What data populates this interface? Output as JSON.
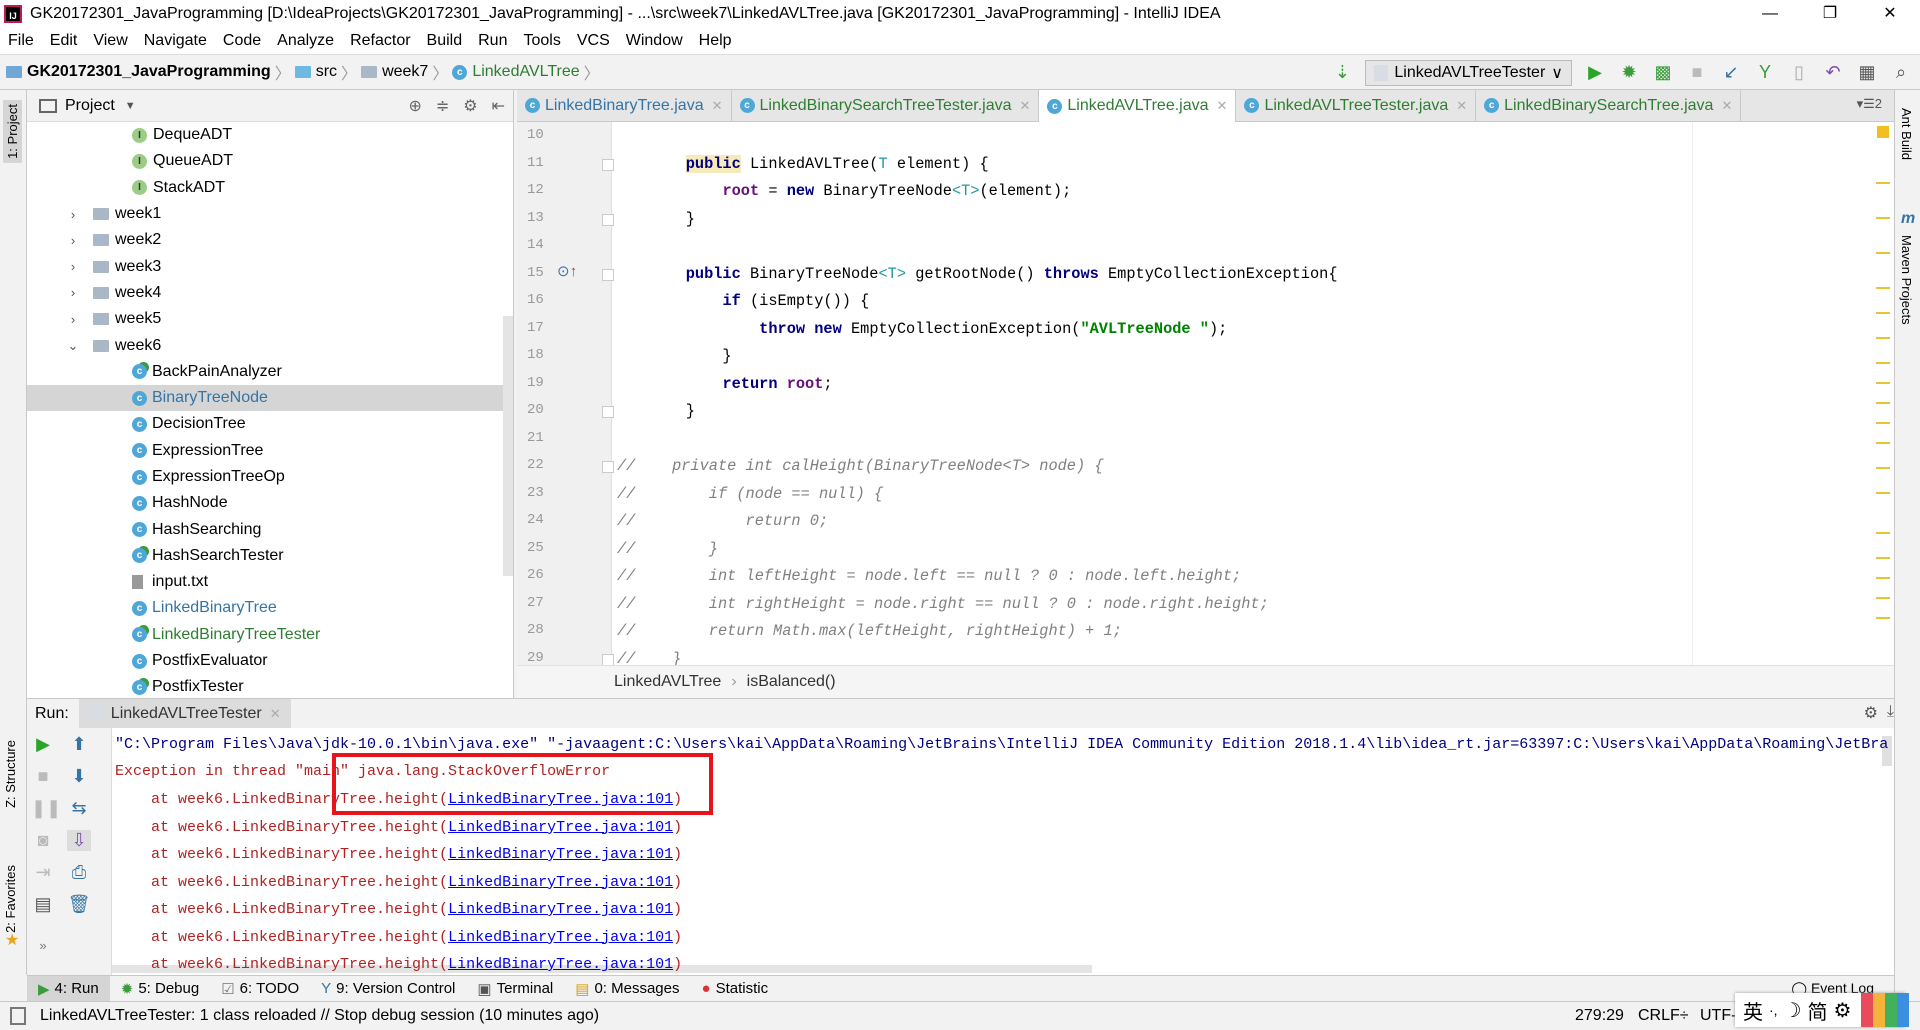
{
  "window": {
    "title": "GK20172301_JavaProgramming [D:\\IdeaProjects\\GK20172301_JavaProgramming] - ...\\src\\week7\\LinkedAVLTree.java [GK20172301_JavaProgramming] - IntelliJ IDEA",
    "minimize": "—",
    "restore": "❐",
    "close": "✕"
  },
  "menu": [
    "File",
    "Edit",
    "View",
    "Navigate",
    "Code",
    "Analyze",
    "Refactor",
    "Build",
    "Run",
    "Tools",
    "VCS",
    "Window",
    "Help"
  ],
  "nav": {
    "project": "GK20172301_JavaProgramming",
    "src": "src",
    "week": "week7",
    "file": "LinkedAVLTree",
    "sep": "〉"
  },
  "toolbar": {
    "run_config": "LinkedAVLTreeTester",
    "dropdown": "∨",
    "icons": [
      "sort-icon",
      "run-icon",
      "debug-icon",
      "coverage-icon",
      "stop-icon",
      "vcs-update-icon",
      "vcs-commit-icon",
      "vcs-compare-icon",
      "vcs-revert-icon",
      "project-structure-icon",
      "search-icon"
    ]
  },
  "left_strip": {
    "project": "1: Project",
    "structure": "Z: Structure",
    "favorites": "2: Favorites"
  },
  "right_strip": {
    "ant": "Ant Build",
    "maven": "Maven Projects"
  },
  "project_panel": {
    "title": "Project",
    "tree": [
      {
        "label": "DequeADT",
        "icon": "interface",
        "indent": 3
      },
      {
        "label": "QueueADT",
        "icon": "interface",
        "indent": 3
      },
      {
        "label": "StackADT",
        "icon": "interface",
        "indent": 3
      },
      {
        "label": "week1",
        "icon": "folder",
        "indent": 2,
        "arrow": "›"
      },
      {
        "label": "week2",
        "icon": "folder",
        "indent": 2,
        "arrow": "›"
      },
      {
        "label": "week3",
        "icon": "folder",
        "indent": 2,
        "arrow": "›"
      },
      {
        "label": "week4",
        "icon": "folder",
        "indent": 2,
        "arrow": "›"
      },
      {
        "label": "week5",
        "icon": "folder",
        "indent": 2,
        "arrow": "›"
      },
      {
        "label": "week6",
        "icon": "folder",
        "indent": 2,
        "arrow": "⌄"
      },
      {
        "label": "BackPainAnalyzer",
        "icon": "class-main",
        "indent": 3
      },
      {
        "label": "BinaryTreeNode",
        "icon": "class",
        "indent": 3,
        "selected": true,
        "color": "#3574a5"
      },
      {
        "label": "DecisionTree",
        "icon": "class",
        "indent": 3
      },
      {
        "label": "ExpressionTree",
        "icon": "class",
        "indent": 3
      },
      {
        "label": "ExpressionTreeOp",
        "icon": "class",
        "indent": 3
      },
      {
        "label": "HashNode",
        "icon": "class",
        "indent": 3
      },
      {
        "label": "HashSearching",
        "icon": "class",
        "indent": 3
      },
      {
        "label": "HashSearchTester",
        "icon": "class-main",
        "indent": 3
      },
      {
        "label": "input.txt",
        "icon": "text",
        "indent": 3
      },
      {
        "label": "LinkedBinaryTree",
        "icon": "class",
        "indent": 3,
        "color": "#3574a5"
      },
      {
        "label": "LinkedBinaryTreeTester",
        "icon": "class-main",
        "indent": 3,
        "color": "#2f7d32"
      },
      {
        "label": "PostfixEvaluator",
        "icon": "class",
        "indent": 3
      },
      {
        "label": "PostfixTester",
        "icon": "class-main",
        "indent": 3
      }
    ]
  },
  "tabs": [
    {
      "label": "LinkedBinaryTree.java",
      "color": "blue"
    },
    {
      "label": "LinkedBinarySearchTreeTester.java",
      "color": "green"
    },
    {
      "label": "LinkedAVLTree.java",
      "color": "green",
      "active": true
    },
    {
      "label": "LinkedAVLTreeTester.java",
      "color": "green"
    },
    {
      "label": "LinkedBinarySearchTree.java",
      "color": "green"
    }
  ],
  "tabs_overflow": "▾☰2",
  "editor": {
    "lines": [
      {
        "n": "10",
        "t": []
      },
      {
        "n": "11",
        "t": [
          [
            "    ",
            ""
          ],
          [
            "public",
            "kw hl"
          ],
          [
            " LinkedAVLTree(",
            ""
          ],
          [
            "T",
            "typ"
          ],
          [
            " element) {",
            ""
          ]
        ]
      },
      {
        "n": "12",
        "t": [
          [
            "        ",
            ""
          ],
          [
            "root",
            "fld"
          ],
          [
            " = ",
            ""
          ],
          [
            "new",
            "kw"
          ],
          [
            " BinaryTreeNode",
            ""
          ],
          [
            "<T>",
            "typ"
          ],
          [
            "(element);",
            ""
          ]
        ]
      },
      {
        "n": "13",
        "t": [
          [
            "    }",
            ""
          ]
        ]
      },
      {
        "n": "14",
        "t": []
      },
      {
        "n": "15",
        "t": [
          [
            "    ",
            ""
          ],
          [
            "public",
            "kw"
          ],
          [
            " BinaryTreeNode",
            ""
          ],
          [
            "<T>",
            "typ"
          ],
          [
            " getRootNode() ",
            ""
          ],
          [
            "throws",
            "kw"
          ],
          [
            " EmptyCollectionException{",
            ""
          ]
        ]
      },
      {
        "n": "16",
        "t": [
          [
            "        ",
            ""
          ],
          [
            "if",
            "kw"
          ],
          [
            " (isEmpty()) {",
            ""
          ]
        ]
      },
      {
        "n": "17",
        "t": [
          [
            "            ",
            ""
          ],
          [
            "throw new",
            "kw"
          ],
          [
            " EmptyCollectionException(",
            ""
          ],
          [
            "\"AVLTreeNode \"",
            "str"
          ],
          [
            ");",
            ""
          ]
        ]
      },
      {
        "n": "18",
        "t": [
          [
            "        }",
            ""
          ]
        ]
      },
      {
        "n": "19",
        "t": [
          [
            "        ",
            ""
          ],
          [
            "return",
            "kw"
          ],
          [
            " ",
            ""
          ],
          [
            "root",
            "fld"
          ],
          [
            ";",
            ""
          ]
        ]
      },
      {
        "n": "20",
        "t": [
          [
            "    }",
            ""
          ]
        ]
      },
      {
        "n": "21",
        "t": []
      },
      {
        "n": "22",
        "t": [
          [
            "//    private int calHeight(BinaryTreeNode<T> node) {",
            "cm"
          ]
        ]
      },
      {
        "n": "23",
        "t": [
          [
            "//        if (node == null) {",
            "cm"
          ]
        ]
      },
      {
        "n": "24",
        "t": [
          [
            "//            return 0;",
            "cm"
          ]
        ]
      },
      {
        "n": "25",
        "t": [
          [
            "//        }",
            "cm"
          ]
        ]
      },
      {
        "n": "26",
        "t": [
          [
            "//        int leftHeight = node.left == null ? 0 : node.left.height;",
            "cm"
          ]
        ]
      },
      {
        "n": "27",
        "t": [
          [
            "//        int rightHeight = node.right == null ? 0 : node.right.height;",
            "cm"
          ]
        ]
      },
      {
        "n": "28",
        "t": [
          [
            "//        return Math.max(leftHeight, rightHeight) + 1;",
            "cm"
          ]
        ]
      },
      {
        "n": "29",
        "t": [
          [
            "//    }",
            "cm"
          ]
        ]
      }
    ],
    "breadcrumb": {
      "class": "LinkedAVLTree",
      "sep": "›",
      "method": "isBalanced()"
    }
  },
  "run": {
    "label": "Run:",
    "tab": "LinkedAVLTreeTester",
    "command": "\"C:\\Program Files\\Java\\jdk-10.0.1\\bin\\java.exe\" \"-javaagent:C:\\Users\\kai\\AppData\\Roaming\\JetBrains\\IntelliJ IDEA Community Edition 2018.1.4\\lib\\idea_rt.jar=63397:C:\\Users\\kai\\AppData\\Roaming\\JetBra",
    "exception": "Exception in thread \"main\" java.lang.StackOverflowError",
    "frame_prefix": "    at week6.LinkedBinaryTree.height(",
    "frame_link": "LinkedBinaryTree.java:101",
    "frame_suffix": ")",
    "frame_count": 7
  },
  "bottom_tabs": [
    {
      "label": "4: Run",
      "icon": "▶",
      "color": "#3a9c3a",
      "active": true
    },
    {
      "label": "5: Debug",
      "icon": "✹",
      "color": "#3a9c3a"
    },
    {
      "label": "6: TODO",
      "icon": "☑",
      "color": "#777"
    },
    {
      "label": "9: Version Control",
      "icon": "Y",
      "color": "#3574a5"
    },
    {
      "label": "Terminal",
      "icon": "▣",
      "color": "#555"
    },
    {
      "label": "0: Messages",
      "icon": "▤",
      "color": "#d4a017"
    },
    {
      "label": "Statistic",
      "icon": "●",
      "color": "#d33"
    }
  ],
  "event_log": "Event Log",
  "status": {
    "message": "LinkedAVLTreeTester: 1 class reloaded // Stop debug session (10 minutes ago)",
    "position": "279:29",
    "line_sep": "CRLF÷",
    "encoding": "UTF-8"
  },
  "ime": {
    "lang": "英",
    "punct": "·,",
    "moon": "☽",
    "simp": "简",
    "gear": "⚙"
  }
}
